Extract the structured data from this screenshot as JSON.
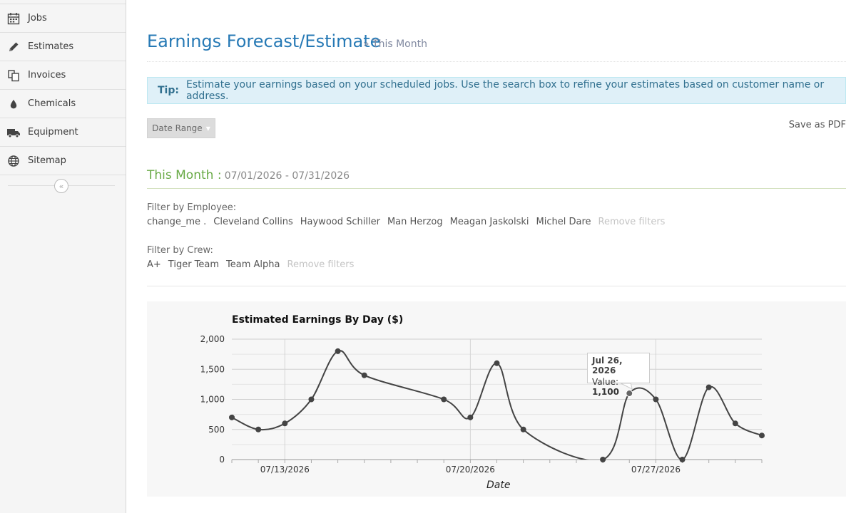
{
  "sidebar": {
    "items": [
      {
        "label": "Jobs",
        "icon": "calendar-icon"
      },
      {
        "label": "Estimates",
        "icon": "pencil-icon"
      },
      {
        "label": "Invoices",
        "icon": "copy-icon"
      },
      {
        "label": "Chemicals",
        "icon": "tint-icon"
      },
      {
        "label": "Equipment",
        "icon": "truck-icon"
      },
      {
        "label": "Sitemap",
        "icon": "globe-icon"
      }
    ],
    "collapse_glyph": "«"
  },
  "header": {
    "title": "Earnings Forecast/Estimate",
    "subtitle": "» This Month"
  },
  "tip": {
    "label": "Tip:",
    "text": "Estimate your earnings based on your scheduled jobs. Use the search box to refine your estimates based on customer name or address."
  },
  "toolbar": {
    "date_range_label": "Date Range",
    "save_pdf_label": "Save as PDF"
  },
  "period": {
    "title": "This Month :",
    "range": "07/01/2026 - 07/31/2026"
  },
  "filters": {
    "employee_label": "Filter by Employee:",
    "employees": [
      "change_me .",
      "Cleveland Collins",
      "Haywood Schiller",
      "Man Herzog",
      "Meagan Jaskolski",
      "Michel Dare"
    ],
    "employee_remove": "Remove filters",
    "crew_label": "Filter by Crew:",
    "crews": [
      "A+",
      "Tiger Team",
      "Team Alpha"
    ],
    "crew_remove": "Remove filters"
  },
  "tooltip": {
    "date": "Jul 26, 2026",
    "value_label": "Value:",
    "value": "1,100"
  },
  "chart_data": {
    "type": "line",
    "title": "Estimated Earnings By Day ($)",
    "xlabel": "Date",
    "ylabel": "",
    "ylim": [
      0,
      2000
    ],
    "y_ticks": [
      "0",
      "500",
      "1,000",
      "1,500",
      "2,000"
    ],
    "x_tick_labels": [
      {
        "day": 13,
        "label": "07/13/2026"
      },
      {
        "day": 20,
        "label": "07/20/2026"
      },
      {
        "day": 27,
        "label": "07/27/2026"
      }
    ],
    "x_range_days": [
      11,
      31
    ],
    "points": [
      {
        "day": 11,
        "value": 700
      },
      {
        "day": 12,
        "value": 500
      },
      {
        "day": 13,
        "value": 600
      },
      {
        "day": 14,
        "value": 1000
      },
      {
        "day": 15,
        "value": 1800
      },
      {
        "day": 16,
        "value": 1400
      },
      {
        "day": 19,
        "value": 1000
      },
      {
        "day": 20,
        "value": 700
      },
      {
        "day": 21,
        "value": 1600
      },
      {
        "day": 22,
        "value": 500
      },
      {
        "day": 25,
        "value": 0
      },
      {
        "day": 26,
        "value": 1100
      },
      {
        "day": 27,
        "value": 1000
      },
      {
        "day": 28,
        "value": 0
      },
      {
        "day": 29,
        "value": 1200
      },
      {
        "day": 30,
        "value": 600
      },
      {
        "day": 31,
        "value": 400
      }
    ],
    "highlight_day": 26,
    "grid": true,
    "line_color": "#444444"
  }
}
